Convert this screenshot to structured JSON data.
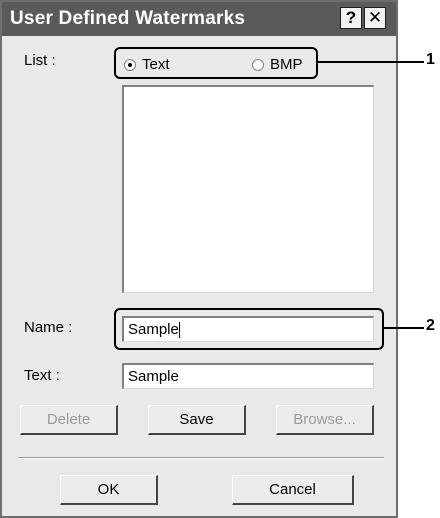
{
  "window": {
    "title": "User Defined Watermarks",
    "help_glyph": "?",
    "close_glyph": "✕"
  },
  "list": {
    "label": "List :",
    "radio_options": [
      {
        "label": "Text",
        "selected": true
      },
      {
        "label": "BMP",
        "selected": false
      }
    ]
  },
  "name_field": {
    "label": "Name :",
    "value": "Sample"
  },
  "text_field": {
    "label": "Text :",
    "value": "Sample"
  },
  "action_buttons": {
    "delete": "Delete",
    "save": "Save",
    "browse": "Browse..."
  },
  "footer_buttons": {
    "ok": "OK",
    "cancel": "Cancel"
  },
  "callouts": [
    "1",
    "2"
  ]
}
